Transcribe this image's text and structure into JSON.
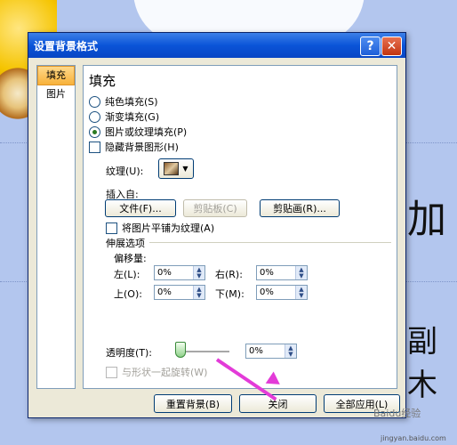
{
  "dialog": {
    "title": "设置背景格式",
    "help_icon": "?",
    "close_icon": "✕"
  },
  "nav": {
    "items": [
      {
        "label": "填充",
        "selected": true
      },
      {
        "label": "图片",
        "selected": false
      }
    ]
  },
  "fill": {
    "heading": "填充",
    "options": [
      {
        "label": "纯色填充(S)",
        "checked": false
      },
      {
        "label": "渐变填充(G)",
        "checked": false
      },
      {
        "label": "图片或纹理填充(P)",
        "checked": true
      }
    ],
    "hide_bg_label": "隐藏背景图形(H)",
    "texture_label": "纹理(U):",
    "insert_from_label": "插入自:",
    "file_button": "文件(F)...",
    "clipboard_button": "剪贴板(C)",
    "clipart_button": "剪贴画(R)...",
    "tile_label": "将图片平铺为纹理(A)",
    "stretch_label": "伸展选项",
    "offset_label": "偏移量:",
    "left_label": "左(L):",
    "left_value": "0%",
    "right_label": "右(R):",
    "right_value": "0%",
    "top_label": "上(O):",
    "top_value": "0%",
    "bottom_label": "下(M):",
    "bottom_value": "0%",
    "transparency_label": "透明度(T):",
    "transparency_value": "0%",
    "rotate_label": "与形状一起旋转(W)"
  },
  "buttons": {
    "reset": "重置背景(B)",
    "close": "关闭",
    "apply_all": "全部应用(L)"
  },
  "slide": {
    "text1": "加",
    "text2": "副木"
  },
  "watermark": {
    "line1": "Baidu经验",
    "line2": "jingyan.baidu.com"
  }
}
